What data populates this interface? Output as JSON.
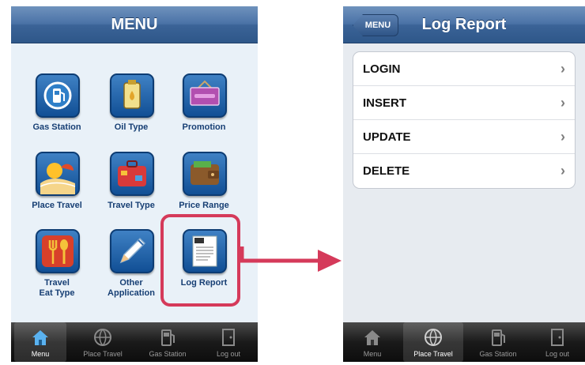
{
  "left_screen": {
    "title": "MENU",
    "items": [
      {
        "label": "Gas Station",
        "icon": "gas-pump-icon"
      },
      {
        "label": "Oil Type",
        "icon": "oil-bottle-icon"
      },
      {
        "label": "Promotion",
        "icon": "promotion-sign-icon"
      },
      {
        "label": "Place Travel",
        "icon": "beach-sun-icon"
      },
      {
        "label": "Travel Type",
        "icon": "suitcase-icon"
      },
      {
        "label": "Price Range",
        "icon": "wallet-icon"
      },
      {
        "label": "Travel\nEat Type",
        "icon": "fork-spoon-icon"
      },
      {
        "label": "Other\nApplication",
        "icon": "pencil-icon"
      },
      {
        "label": "Log Report",
        "icon": "log-document-icon"
      }
    ],
    "tabs": [
      {
        "label": "Menu",
        "icon": "home-icon"
      },
      {
        "label": "Place Travel",
        "icon": "globe-icon"
      },
      {
        "label": "Gas Station",
        "icon": "fuel-pump-icon"
      },
      {
        "label": "Log out",
        "icon": "door-icon"
      }
    ]
  },
  "right_screen": {
    "back_label": "MENU",
    "title": "Log Report",
    "rows": [
      "LOGIN",
      "INSERT",
      "UPDATE",
      "DELETE"
    ],
    "chevron": "›",
    "tabs": [
      {
        "label": "Menu",
        "icon": "home-icon"
      },
      {
        "label": "Place Travel",
        "icon": "globe-icon"
      },
      {
        "label": "Gas Station",
        "icon": "fuel-pump-icon"
      },
      {
        "label": "Log out",
        "icon": "door-icon"
      }
    ]
  },
  "colors": {
    "navbar": "#3b6397",
    "highlight": "#d53a5a",
    "arrow": "#d53a5a",
    "tile": "#1a5aa0"
  }
}
